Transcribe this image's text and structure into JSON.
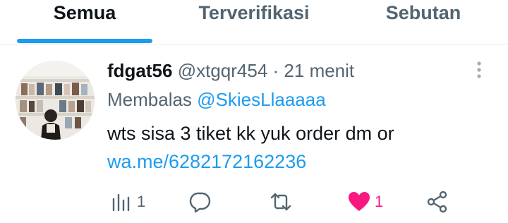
{
  "tabs": [
    {
      "label": "Semua",
      "active": true
    },
    {
      "label": "Terverifikasi",
      "active": false
    },
    {
      "label": "Sebutan",
      "active": false
    }
  ],
  "tweet": {
    "display_name": "fdgat56",
    "handle": "@xtgqr454",
    "separator": "·",
    "time": "21 menit",
    "reply_prefix": "Membalas",
    "reply_to": "@SkiesLlaaaaa",
    "text_line1": "wts sisa 3 tiket  kk yuk order dm or",
    "link": "wa.me/6282172162236",
    "avatar_icon": "profile-photo-bookshelf",
    "actions": {
      "views_count": "1",
      "like_count": "1",
      "liked": true
    }
  },
  "colors": {
    "accent": "#1d9bf0",
    "like": "#f91880",
    "muted": "#536471",
    "text": "#0f1419"
  }
}
